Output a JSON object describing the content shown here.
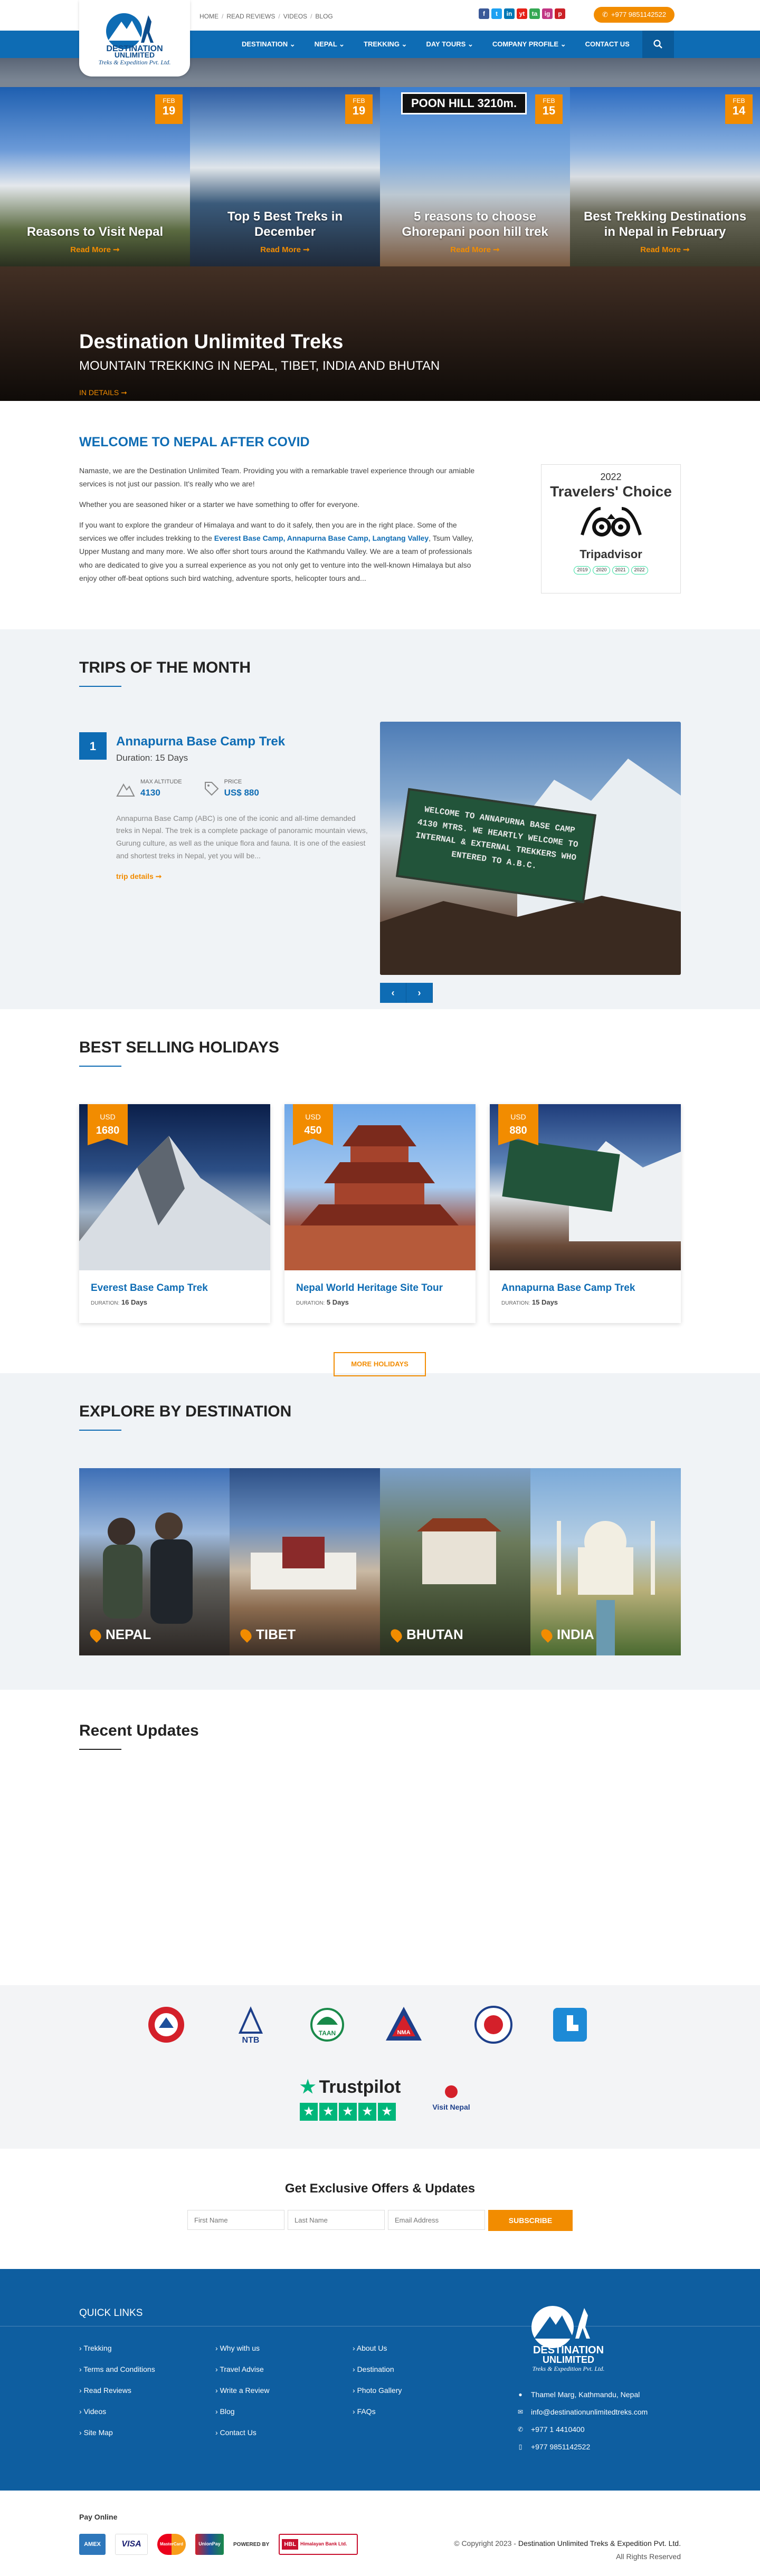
{
  "header": {
    "top_links": [
      "HOME",
      "READ REVIEWS",
      "VIDEOS",
      "BLOG"
    ],
    "social": [
      "f",
      "t",
      "in",
      "yt",
      "ta",
      "ig",
      "p"
    ],
    "phone": "+977 9851142522",
    "logo_line1": "DESTINATION",
    "logo_line2": "UNLIMITED",
    "logo_tag": "Treks & Expedition Pvt. Ltd.",
    "menu": [
      "DESTINATION",
      "NEPAL",
      "TREKKING",
      "DAY TOURS",
      "COMPANY PROFILE",
      "CONTACT US"
    ]
  },
  "hero": {
    "title": "Destination Unlimited Treks",
    "subtitle": "MOUNTAIN TREKKING IN NEPAL, TIBET, INDIA AND BHUTAN",
    "details": "IN DETAILS"
  },
  "welcome": {
    "title": "WELCOME TO NEPAL AFTER COVID",
    "p1": "Namaste, we are the Destination Unlimited Team. Providing you with a remarkable travel experience through our amiable services is not just our passion. It's really who we are!",
    "p2": "Whether you are seasoned hiker or a starter we have something to offer for everyone.",
    "p3a": "If you want to explore the grandeur of Himalaya and want to do it safely, then you are in the right place. Some of the services we offer includes trekking to the ",
    "p3b": "Everest Base Camp, Annapurna Base Camp, Langtang Valley",
    "p3c": ", Tsum Valley, Upper Mustang and many more. We also offer short tours around the Kathmandu Valley. We are a team of professionals who are dedicated to give you a surreal experience as you not only get to venture into the well-known Himalaya but also enjoy other off-beat options such bird watching, adventure sports, helicopter tours and...",
    "award_year": "2022",
    "award_title": "Travelers' Choice",
    "award_brand": "Tripadvisor",
    "award_years": [
      "2019",
      "2020",
      "2021",
      "2022"
    ]
  },
  "trips": {
    "title": "TRIPS OF THE MONTH",
    "num": "1",
    "name": "Annapurna Base Camp Trek",
    "duration": "Duration: 15 Days",
    "alt_label": "MAX ALTITUDE",
    "alt_value": "4130",
    "price_label": "PRICE",
    "price_value": "US$ 880",
    "desc": "Annapurna Base Camp (ABC) is one of the iconic and all-time demanded treks in Nepal. The trek is a complete package of panoramic mountain views, Gurung culture, as well as the unique flora and fauna. It is one of the easiest and shortest treks in Nepal, yet you will be...",
    "more": "trip details",
    "sign_text": "WELCOME TO ANNAPURNA BASE CAMP 4130 MTRS. WE HEARTLY WELCOME TO INTERNAL & EXTERNAL TREKKERS WHO ENTERED TO A.B.C.",
    "prev": "‹",
    "next": "›"
  },
  "best": {
    "title": "BEST SELLING HOLIDAYS",
    "cards": [
      {
        "currency": "USD",
        "price": "1680",
        "name": "Everest Base Camp Trek",
        "dlabel": "DURATION:",
        "days": "16 Days"
      },
      {
        "currency": "USD",
        "price": "450",
        "name": "Nepal World Heritage Site Tour",
        "dlabel": "DURATION:",
        "days": "5 Days"
      },
      {
        "currency": "USD",
        "price": "880",
        "name": "Annapurna Base Camp Trek",
        "dlabel": "DURATION:",
        "days": "15 Days"
      }
    ],
    "more": "MORE HOLIDAYS"
  },
  "destinations": {
    "title": "EXPLORE BY DESTINATION",
    "items": [
      "NEPAL",
      "TIBET",
      "BHUTAN",
      "INDIA"
    ]
  },
  "recent": {
    "title": "Recent Updates",
    "items": [
      {
        "month": "FEB",
        "day": "19",
        "title": "Reasons to Visit Nepal",
        "more": "Read More"
      },
      {
        "month": "FEB",
        "day": "19",
        "title": "Top 5 Best Treks in December",
        "more": "Read More"
      },
      {
        "month": "FEB",
        "day": "15",
        "title": "5 reasons to choose Ghorepani poon hill trek",
        "more": "Read More"
      },
      {
        "month": "FEB",
        "day": "14",
        "title": "Best Trekking Destinations in Nepal in February",
        "more": "Read More"
      }
    ],
    "poon_hill": "POON HILL 3210m."
  },
  "partners": {
    "ntb": "NTB",
    "taan": "TAAN",
    "nma": "NMA",
    "trustpilot": "Trustpilot",
    "visit_nepal": "Visit Nepal"
  },
  "newsletter": {
    "title": "Get Exclusive Offers & Updates",
    "first": "First Name",
    "last": "Last Name",
    "email": "Email Address",
    "button": "SUBSCRIBE"
  },
  "footer": {
    "quick_links": "QUICK LINKS",
    "col1": [
      "Trekking",
      "Terms and Conditions",
      "Read Reviews",
      "Videos",
      "Site Map"
    ],
    "col2": [
      "Why with us",
      "Travel Advise",
      "Write a Review",
      "Blog",
      "Contact Us"
    ],
    "col3": [
      "About Us",
      "Destination",
      "Photo Gallery",
      "FAQs"
    ],
    "address": "Thamel Marg, Kathmandu, Nepal",
    "email": "info@destinationunlimitedtreks.com",
    "tel": "+977 1 4410400",
    "mobile": "+977 9851142522"
  },
  "bottom": {
    "pay_online": "Pay Online",
    "cards": [
      "AMEX",
      "VISA",
      "MasterCard",
      "UnionPay"
    ],
    "powered": "POWERED BY",
    "hbl": "HBL",
    "himalayan": "Himalayan Bank Ltd.",
    "copy_prefix": "© Copyright 2023 - ",
    "copy_company": "Destination Unlimited Treks & Expedition Pvt. Ltd.",
    "rights": "All Rights Reserved"
  },
  "colors": {
    "primary": "#0e6cb4",
    "accent": "#f28c00",
    "footer": "#0e5ea0"
  }
}
